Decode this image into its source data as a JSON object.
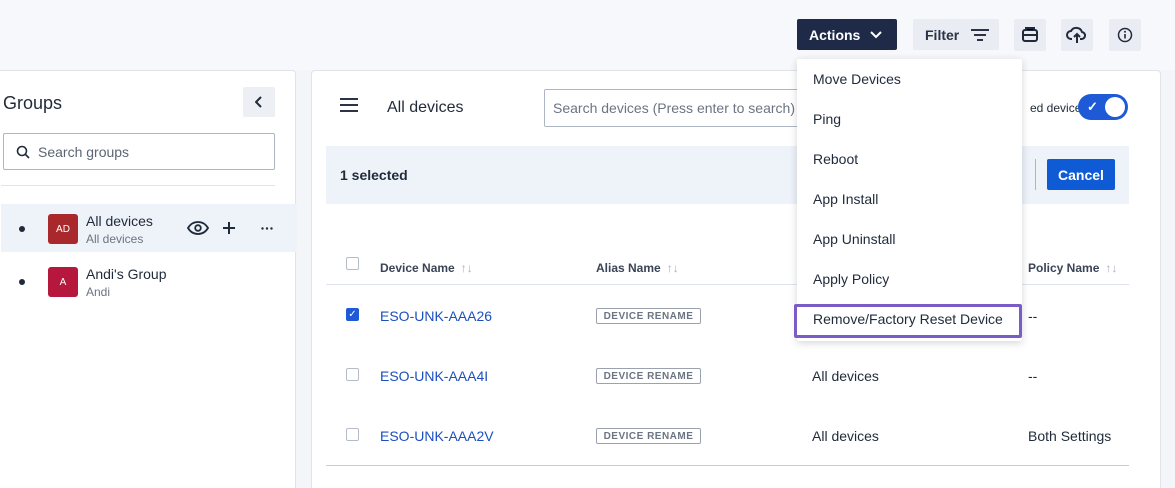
{
  "toolbar": {
    "actions_label": "Actions",
    "filter_label": "Filter"
  },
  "groups": {
    "title": "Groups",
    "search_placeholder": "Search groups",
    "items": [
      {
        "initials": "AD",
        "name": "All devices",
        "sub": "All devices",
        "color": "#a8282b"
      },
      {
        "initials": "A",
        "name": "Andi's Group",
        "sub": "Andi",
        "color": "#b5173d"
      }
    ]
  },
  "main": {
    "title": "All devices",
    "search_placeholder": "Search devices (Press enter to search)",
    "toggle_label": "ed devices",
    "selection_text": "1 selected",
    "cancel_label": "Cancel",
    "columns": [
      "Device Name",
      "Alias Name",
      "Policy Name"
    ],
    "sort_glyph": "↑↓",
    "rows": [
      {
        "checked": true,
        "device": "ESO-UNK-AAA26",
        "alias": "DEVICE RENAME",
        "group": "",
        "policy": "--"
      },
      {
        "checked": false,
        "device": "ESO-UNK-AAA4I",
        "alias": "DEVICE RENAME",
        "group": "All devices",
        "policy": "--"
      },
      {
        "checked": false,
        "device": "ESO-UNK-AAA2V",
        "alias": "DEVICE RENAME",
        "group": "All devices",
        "policy": "Both Settings"
      }
    ]
  },
  "actions_menu": {
    "items": [
      "Move Devices",
      "Ping",
      "Reboot",
      "App Install",
      "App Uninstall",
      "Apply Policy",
      "Remove/Factory Reset Device"
    ],
    "highlight_color": "#7b5cc7"
  }
}
